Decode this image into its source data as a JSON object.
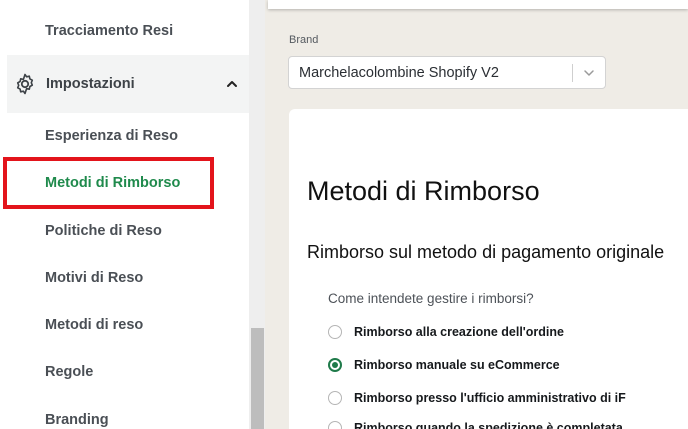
{
  "sidebar": {
    "items_top": [
      {
        "label": "Tracciamento Resi"
      }
    ],
    "section": {
      "label": "Impostazioni",
      "icon": "gear-icon",
      "expanded_icon": "chevron-up-icon"
    },
    "items": [
      {
        "label": "Esperienza di Reso"
      },
      {
        "label": "Metodi di Rimborso",
        "active": true
      },
      {
        "label": "Politiche di Reso"
      },
      {
        "label": "Motivi di Reso"
      },
      {
        "label": "Metodi di reso"
      },
      {
        "label": "Regole"
      },
      {
        "label": "Branding"
      }
    ]
  },
  "brand": {
    "label": "Brand",
    "selected": "Marchelacolombine Shopify V2",
    "icon": "chevron-down-icon"
  },
  "main": {
    "title": "Metodi di Rimborso",
    "section_title": "Rimborso sul metodo di pagamento originale",
    "question": "Come intendete gestire i rimborsi?",
    "options": [
      {
        "label": "Rimborso alla creazione dell'ordine",
        "checked": false
      },
      {
        "label": "Rimborso manuale su eCommerce",
        "checked": true
      },
      {
        "label": "Rimborso presso l'ufficio amministrativo di iF",
        "checked": false
      },
      {
        "label": "Rimborso quando la spedizione è completata",
        "checked": false
      }
    ]
  },
  "colors": {
    "accent": "#1f8a4c",
    "highlight_box": "#e3141b",
    "background": "#efece6"
  }
}
